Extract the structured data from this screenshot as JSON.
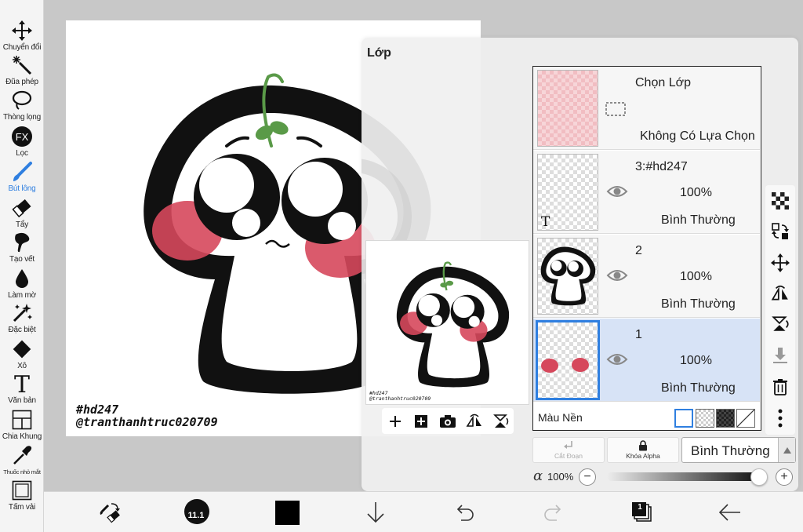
{
  "toolbar": {
    "tools": [
      {
        "id": "transform",
        "label": "Chuyển đổi",
        "icon": "move-arrows-icon"
      },
      {
        "id": "magic-wand",
        "label": "Đũa phép",
        "icon": "magic-wand-icon"
      },
      {
        "id": "lasso",
        "label": "Thòng lọng",
        "icon": "lasso-icon"
      },
      {
        "id": "filter",
        "label": "Lọc",
        "icon": "fx-icon"
      },
      {
        "id": "brush",
        "label": "Bút lông",
        "icon": "brush-icon",
        "active": true
      },
      {
        "id": "eraser",
        "label": "Tẩy",
        "icon": "eraser-icon"
      },
      {
        "id": "smudge",
        "label": "Tạo vết",
        "icon": "smudge-icon"
      },
      {
        "id": "blur",
        "label": "Làm mờ",
        "icon": "blur-drop-icon"
      },
      {
        "id": "special",
        "label": "Đặc biệt",
        "icon": "sparkle-icon"
      },
      {
        "id": "bucket",
        "label": "Xô",
        "icon": "bucket-icon"
      },
      {
        "id": "text",
        "label": "Văn bản",
        "icon": "text-t-icon"
      },
      {
        "id": "frame",
        "label": "Chia Khung",
        "icon": "frame-divider-icon"
      },
      {
        "id": "eyedropper",
        "label": "Thuốc nhỏ mắt",
        "icon": "eyedropper-icon"
      },
      {
        "id": "canvas",
        "label": "Tấm vải",
        "icon": "canvas-icon"
      }
    ],
    "active_color": "#2f7fe0"
  },
  "canvas": {
    "signature_line1": "#hd247",
    "signature_line2": "@tranthanhtruc020709"
  },
  "layer_panel": {
    "title": "Lớp",
    "selection_layer": {
      "name": "Chọn Lớp",
      "status": "Không Có Lựa Chọn"
    },
    "layers": [
      {
        "name": "3:#hd247",
        "opacity": "100%",
        "blend": "Bình Thường",
        "thumb": "text"
      },
      {
        "name": "2",
        "opacity": "100%",
        "blend": "Bình Thường",
        "thumb": "character"
      },
      {
        "name": "1",
        "opacity": "100%",
        "blend": "Bình Thường",
        "thumb": "blush",
        "selected": true
      }
    ],
    "background": {
      "label": "Màu Nền"
    },
    "preview": {
      "signature_line1": "#hd247",
      "signature_line2": "@tranthanhtruc020709"
    },
    "controls": {
      "clipping_label": "Cắt Đoạn",
      "alpha_lock_label": "Khóa Alpha",
      "blend_mode": "Bình Thường",
      "alpha_symbol": "α",
      "alpha_value": "100%",
      "minus": "−",
      "plus": "+"
    }
  },
  "bottom_bar": {
    "brush_size": "11.1",
    "layer_count": "1"
  },
  "colors": {
    "accent": "#2f7fe0",
    "blush": "#d6485c",
    "sprout": "#5a9a48",
    "primary_color": "#000000"
  }
}
